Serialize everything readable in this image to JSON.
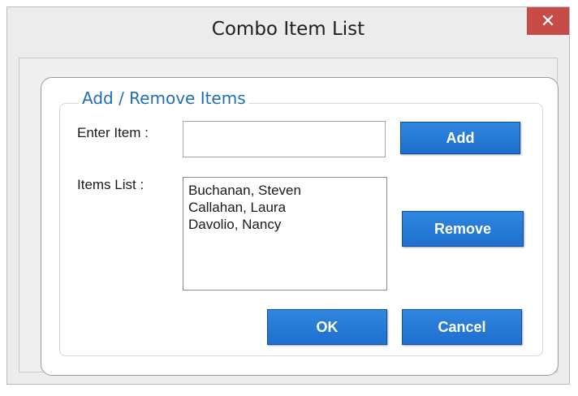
{
  "window": {
    "title": "Combo Item List",
    "close_glyph": "✕"
  },
  "group": {
    "title": "Add / Remove Items"
  },
  "form": {
    "enter_item_label": "Enter Item :",
    "enter_item_value": "",
    "items_list_label": "Items List :",
    "items": [
      "Buchanan, Steven",
      "Callahan, Laura",
      "Davolio, Nancy"
    ]
  },
  "buttons": {
    "add": "Add",
    "remove": "Remove",
    "ok": "OK",
    "cancel": "Cancel"
  },
  "colors": {
    "accent": "#1f6fcf",
    "group_title": "#1f6dbf",
    "close": "#c74b46"
  }
}
